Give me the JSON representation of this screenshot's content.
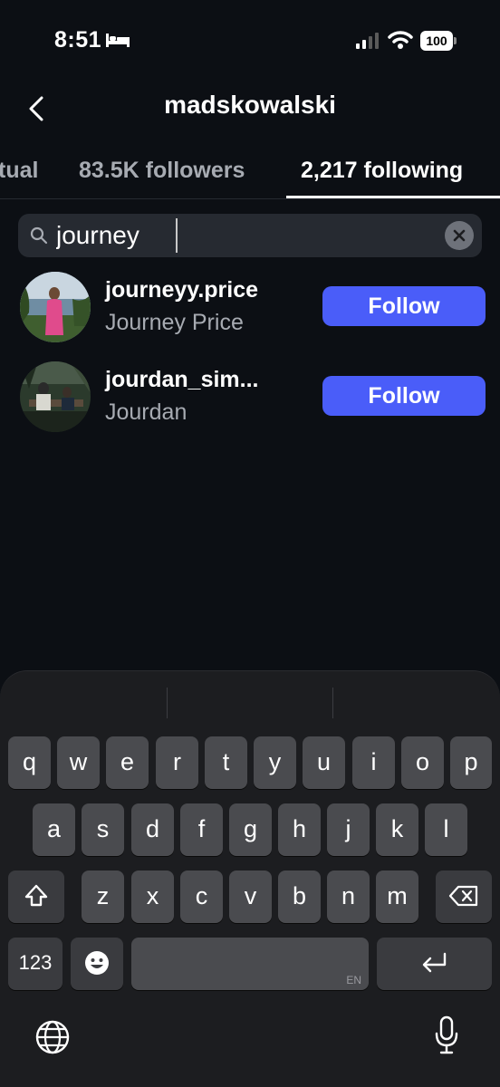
{
  "status_bar": {
    "time": "8:51",
    "battery": "100",
    "sleep_icon": "bed-icon",
    "signal_icon": "cellular-signal-icon",
    "wifi_icon": "wifi-icon"
  },
  "header": {
    "back_icon": "chevron-left-icon",
    "title": "madskowalski"
  },
  "tabs": [
    {
      "label": "tual",
      "active": false
    },
    {
      "label": "83.5K followers",
      "active": false
    },
    {
      "label": "2,217 following",
      "active": true
    }
  ],
  "search": {
    "value": "journey",
    "icon": "search-icon",
    "clear_icon": "clear-icon"
  },
  "results": [
    {
      "username": "journeyy.price",
      "full_name": "Journey Price",
      "button_label": "Follow"
    },
    {
      "username": "jourdan_sim...",
      "full_name": "Jourdan",
      "button_label": "Follow"
    }
  ],
  "keyboard": {
    "row1": [
      "q",
      "w",
      "e",
      "r",
      "t",
      "y",
      "u",
      "i",
      "o",
      "p"
    ],
    "row2": [
      "a",
      "s",
      "d",
      "f",
      "g",
      "h",
      "j",
      "k",
      "l"
    ],
    "row3": [
      "z",
      "x",
      "c",
      "v",
      "b",
      "n",
      "m"
    ],
    "numbers_key": "123",
    "space_lang": "EN",
    "shift_icon": "shift-icon",
    "delete_icon": "backspace-icon",
    "emoji_icon": "emoji-icon",
    "return_icon": "return-icon",
    "globe_icon": "globe-icon",
    "mic_icon": "microphone-icon"
  },
  "colors": {
    "background": "#0c0f14",
    "accent": "#4a5df9",
    "secondary_text": "#a7abb2"
  }
}
